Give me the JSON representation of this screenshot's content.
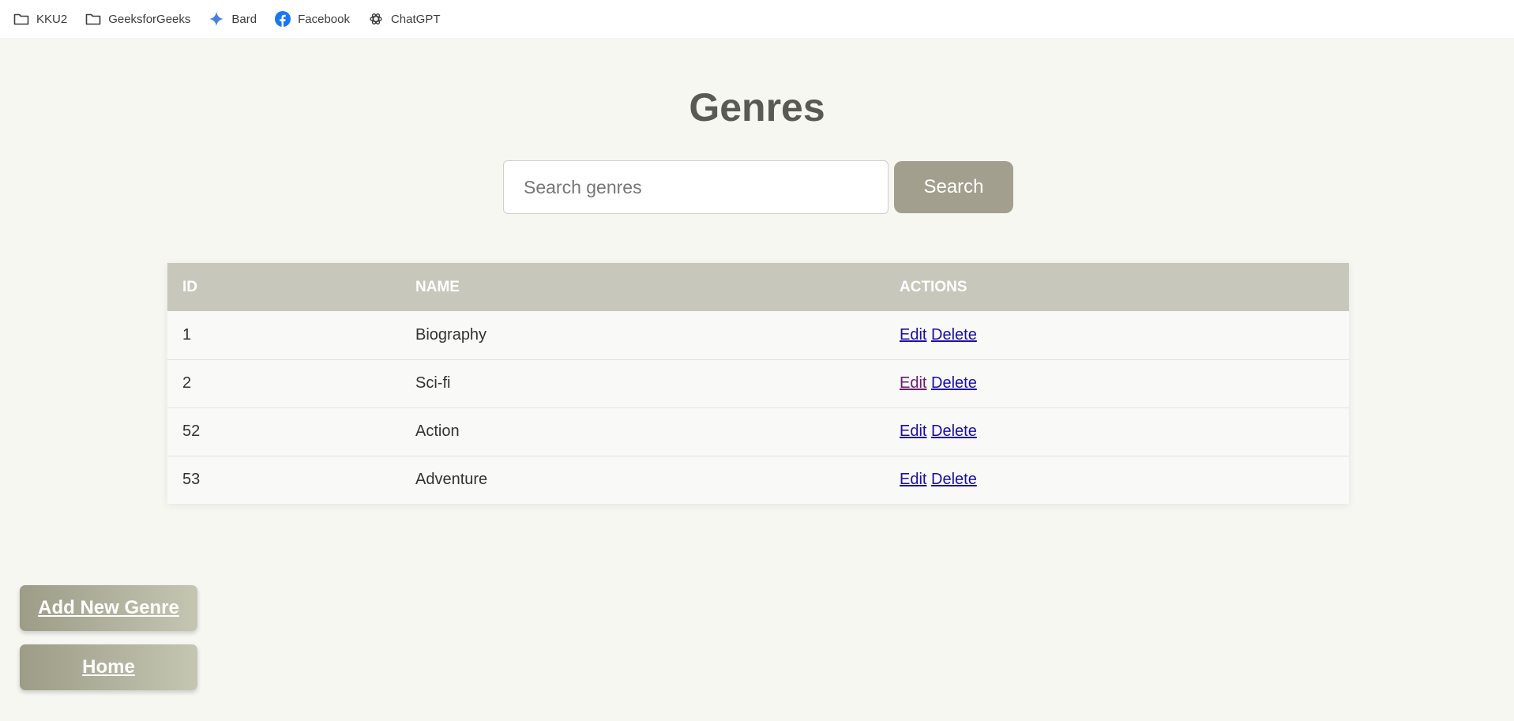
{
  "bookmarks": [
    {
      "label": "KKU2",
      "icon": "folder-icon"
    },
    {
      "label": "GeeksforGeeks",
      "icon": "folder-icon"
    },
    {
      "label": "Bard",
      "icon": "bard-sparkle-icon"
    },
    {
      "label": "Facebook",
      "icon": "facebook-icon"
    },
    {
      "label": "ChatGPT",
      "icon": "chatgpt-icon"
    }
  ],
  "page": {
    "title": "Genres"
  },
  "search": {
    "placeholder": "Search genres",
    "value": "",
    "button_label": "Search"
  },
  "table": {
    "headers": [
      "ID",
      "NAME",
      "ACTIONS"
    ],
    "rows": [
      {
        "id": "1",
        "name": "Biography",
        "edit": "Edit",
        "delete": "Delete"
      },
      {
        "id": "2",
        "name": "Sci-fi",
        "edit": "Edit",
        "delete": "Delete"
      },
      {
        "id": "52",
        "name": "Action",
        "edit": "Edit",
        "delete": "Delete"
      },
      {
        "id": "53",
        "name": "Adventure",
        "edit": "Edit",
        "delete": "Delete"
      }
    ]
  },
  "actions": {
    "add_label": "Add New Genre",
    "home_label": "Home"
  },
  "colors": {
    "background": "#f7f7f2",
    "table_header": "#c7c7bb",
    "search_button": "#a39f8e",
    "link": "#1a0dab",
    "visited_link": "#6a1b6e",
    "facebook": "#1877f2",
    "bard": "#4a7fe0"
  }
}
